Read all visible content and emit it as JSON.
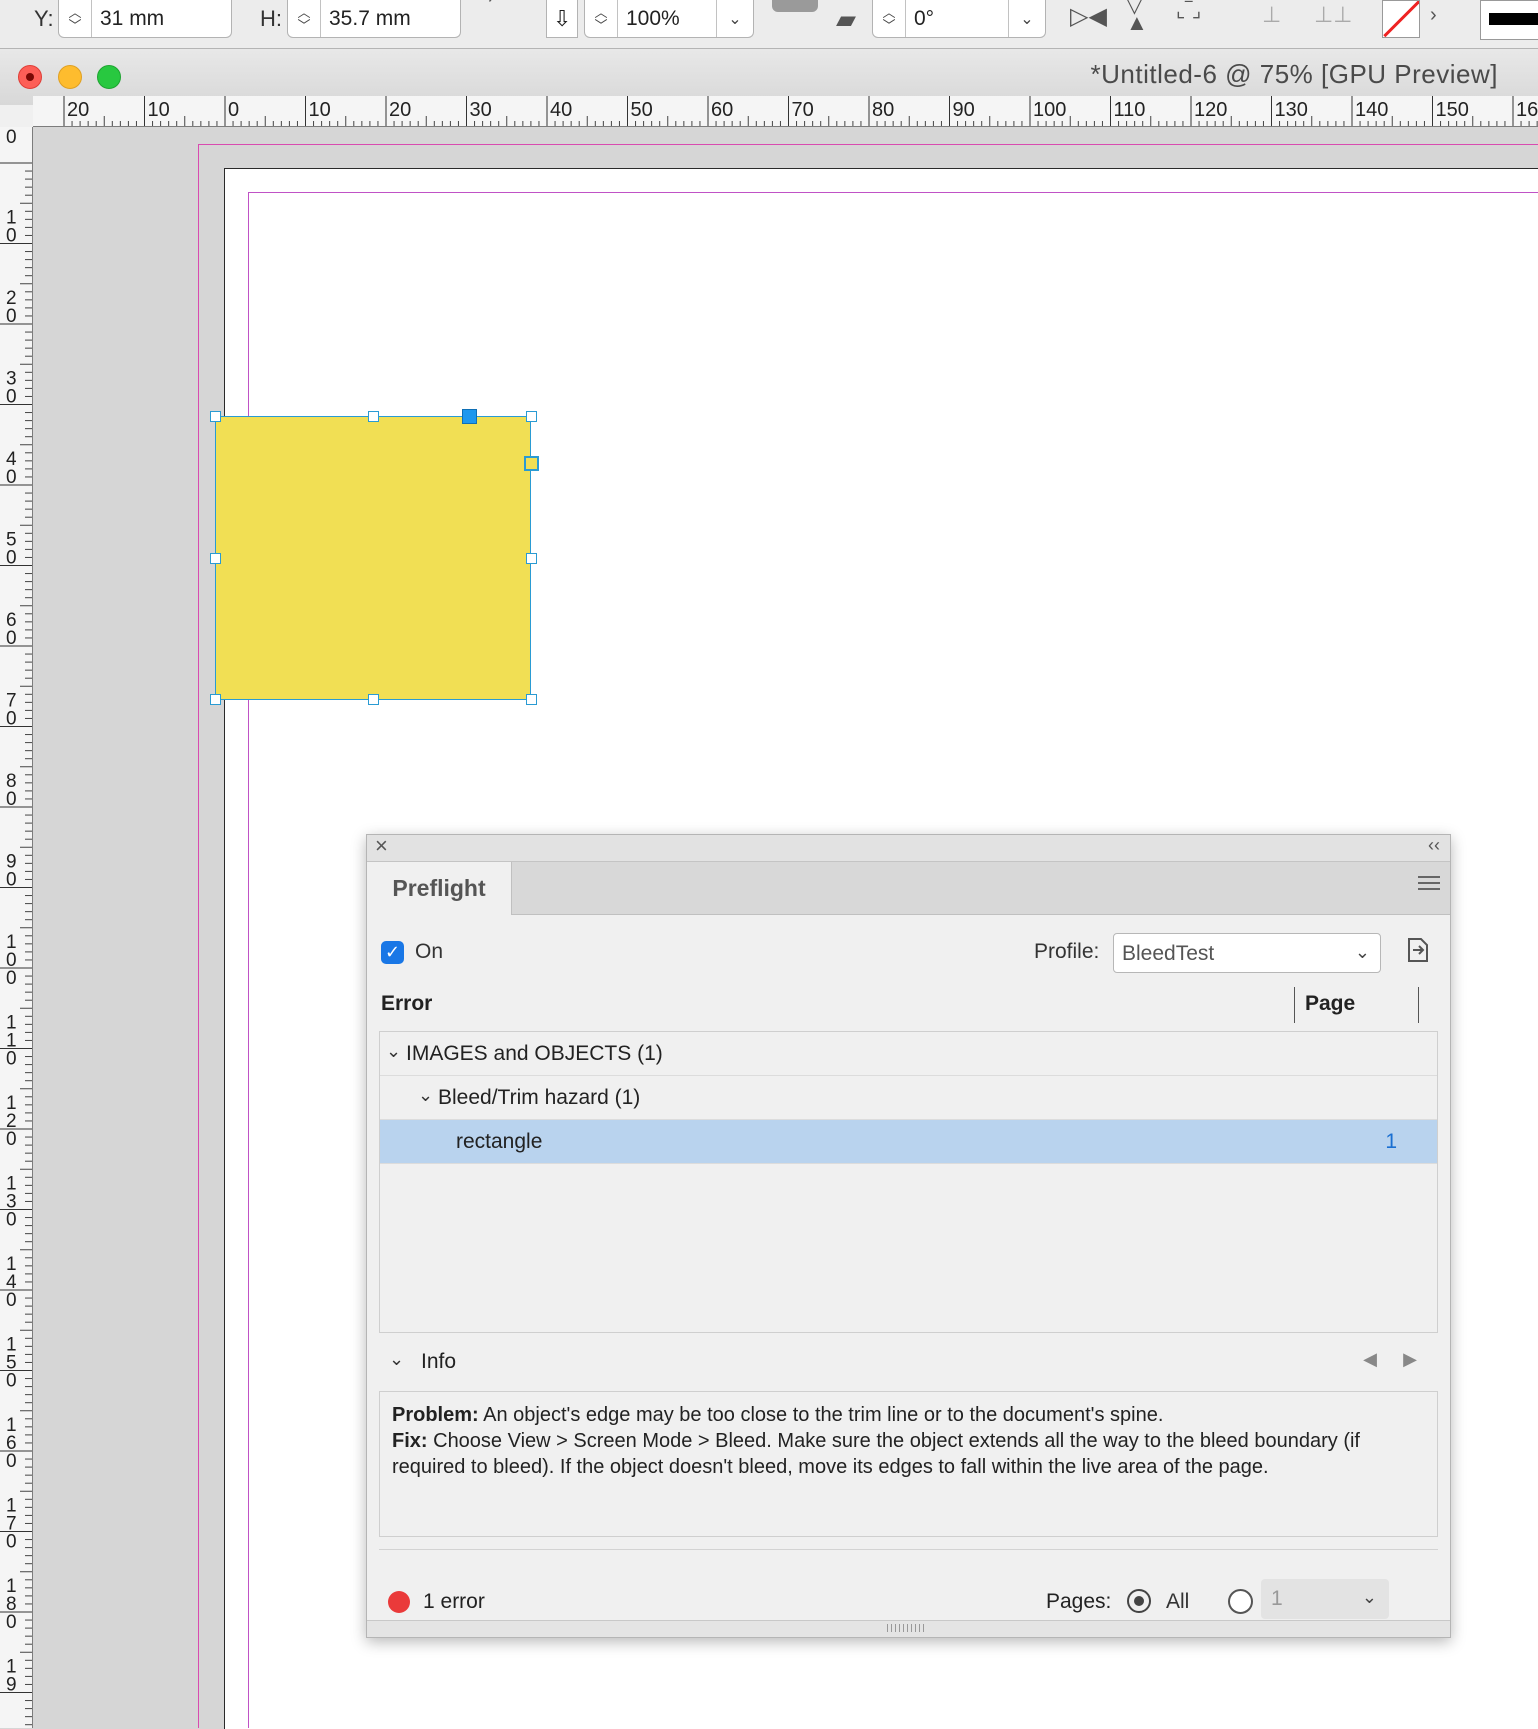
{
  "control_bar": {
    "y_label": "Y:",
    "y_value": "31 mm",
    "h_label": "H:",
    "h_value": "35.7 mm",
    "scale_value": "100%",
    "angle_value": "0°"
  },
  "window": {
    "title": "*Untitled-6 @ 75% [GPU Preview]"
  },
  "ruler": {
    "horizontal": [
      "20",
      "10",
      "0",
      "10",
      "20",
      "30",
      "40",
      "50",
      "60",
      "70",
      "80",
      "90",
      "100",
      "110",
      "120",
      "130",
      "140",
      "150",
      "16"
    ],
    "vertical": [
      "0",
      "10",
      "20",
      "30",
      "40",
      "50",
      "60",
      "70",
      "80",
      "90",
      "100",
      "110",
      "120",
      "130",
      "140",
      "150",
      "160",
      "170",
      "180",
      "19"
    ]
  },
  "canvas": {
    "object_fill": "#f1df54",
    "selection_color": "#2a9bd3",
    "bleed_color": "#d94bb0"
  },
  "preflight": {
    "tab_label": "Preflight",
    "close_icon": "×",
    "collapse_icon": "‹‹",
    "on_label": "On",
    "on_checked": true,
    "profile_label": "Profile:",
    "profile_value": "BleedTest",
    "columns": {
      "error": "Error",
      "page": "Page"
    },
    "rows": [
      {
        "label": "IMAGES and OBJECTS (1)",
        "level": 0,
        "expanded": true
      },
      {
        "label": "Bleed/Trim hazard (1)",
        "level": 1,
        "expanded": true
      },
      {
        "label": "rectangle",
        "level": 2,
        "page": "1",
        "selected": true
      }
    ],
    "info": {
      "label": "Info",
      "problem_label": "Problem:",
      "problem_text": " An object's edge may be too close to the trim line or to the document's spine.",
      "fix_label": "Fix:",
      "fix_text": " Choose View > Screen Mode > Bleed. Make sure the object extends all the way to the bleed boundary (if required to bleed). If the object doesn't bleed, move its edges to fall within the live area of the page."
    },
    "status": {
      "error_count": "1 error",
      "status_color": "#ea3a3a"
    },
    "pages": {
      "label": "Pages:",
      "all_label": "All",
      "range_value": "1"
    }
  }
}
